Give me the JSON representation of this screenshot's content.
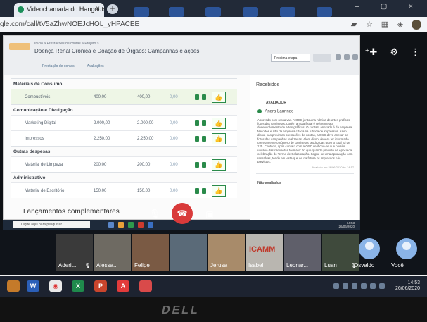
{
  "browser": {
    "tab_title": "Videochamada do Hangouts",
    "tab_close": "×",
    "new_tab": "+",
    "url": "gle.com/call/tV5aZhwNOEJcHOL_yHPACEE",
    "window_controls": "–  ▢  ×"
  },
  "shared_screen": {
    "breadcrumb": "Início  >  Prestações de contas  >  Projeto  >",
    "page_title": "Doença Renal Crônica e Doação de Órgãos: Campanhas e ações",
    "subtabs": [
      "Prestação de contas",
      "Avaliações"
    ],
    "stage_select": "Próxima etapa",
    "sections": [
      {
        "title": "Materiais de Consumo",
        "rows": [
          {
            "name": "Combustíveis",
            "v1": "400,00",
            "v2": "400,00",
            "v3": "0,00",
            "highlight": true
          }
        ]
      },
      {
        "title": "Comunicação e Divulgação",
        "rows": [
          {
            "name": "Marketing Digital",
            "v1": "2.000,00",
            "v2": "2.000,00",
            "v3": "0,00",
            "highlight": false
          },
          {
            "name": "Impressos",
            "v1": "2.250,00",
            "v2": "2.250,00",
            "v3": "0,00",
            "highlight": false
          }
        ]
      },
      {
        "title": "Outras despesas",
        "rows": [
          {
            "name": "Material de Limpeza",
            "v1": "200,00",
            "v2": "200,00",
            "v3": "0,00",
            "highlight": false
          }
        ]
      },
      {
        "title": "Administrativo",
        "rows": [
          {
            "name": "Material de Escritório",
            "v1": "150,00",
            "v2": "150,00",
            "v3": "0,00",
            "highlight": false
          }
        ]
      }
    ],
    "complementares": "Lançamentos complementares",
    "panel": {
      "heading": "Recebidos",
      "avaliador": "AVALIADOR",
      "reviewer": "Angra Laurindo",
      "comment": "Aprovado com ressalvas. A OSC juntou na rubrica de artes gráficas fotos das camisetas; porém a nota fiscal é referente ao desenvolvimento de artes gráficas. O contato anexado é da empresa Metodes e não da empresa citada na rubrica de impressos. Além disso, nas próximas prestações de contas, a OSC deve anexar as fotos das campanhas realizadas. Além disso, deverá ter informado corretamente o número de camisetas produzidas que no total foi de 125. Contudo, após contato com a OSC verificou-se que o valor unitário das camisetas foi maior do que quando previsto na época da celebração do Termo de Colaboração. Segue-se uma aprovação com ressalvas, tendo em vista que na na fatura os impressos não previstos.",
      "posted": "Avaliado em 26/06/2020 às 14:17",
      "not_evaluated": "Não avaliados"
    },
    "remote_search": "Digite aqui para pesquisar",
    "remote_clock_time": "14:53",
    "remote_clock_date": "26/06/2020"
  },
  "participants": [
    {
      "name": "Aderit...",
      "color": "#3a3a3a"
    },
    {
      "name": "Alessa...",
      "color": "#6e6a62"
    },
    {
      "name": "Felipe",
      "color": "#7a5a44"
    },
    {
      "name": "",
      "color": "#5a6a78"
    },
    {
      "name": "Jerusa",
      "color": "#a88b6a"
    },
    {
      "name": "Isabel",
      "color": "#b9b6b0"
    },
    {
      "name": "Leonar...",
      "color": "#5f5f6a"
    },
    {
      "name": "Luan",
      "color": "#3f4a3c"
    },
    {
      "name": "Osvaldo",
      "color": "#4a78b8"
    },
    {
      "name": "Você",
      "color": "#4a78b8"
    }
  ],
  "icamm_text": "ICAMM",
  "local_clock": {
    "time": "14:53",
    "date": "26/06/2020"
  },
  "bezel_brand": "DELL"
}
